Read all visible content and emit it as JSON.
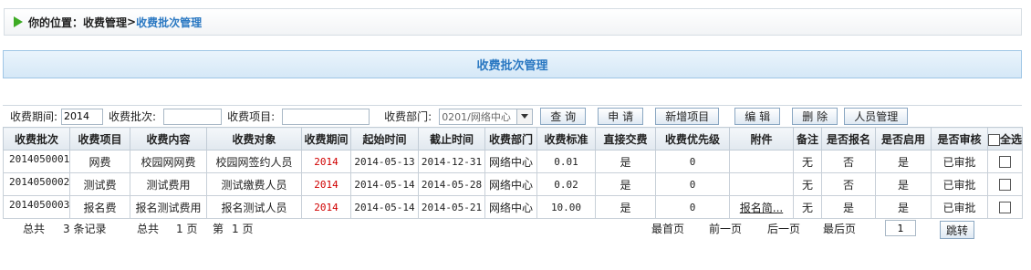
{
  "breadcrumb": {
    "prefix": "你的位置：",
    "parent": "收费管理",
    "separator": ">",
    "current": "收费批次管理"
  },
  "page_title": "收费批次管理",
  "filter": {
    "period_label": "收费期间:",
    "period_value": "2014",
    "batch_label": "收费批次:",
    "batch_value": "",
    "item_label": "收费项目:",
    "item_value": "",
    "dept_label": "收费部门:",
    "dept_selected": "0201/网络中心",
    "buttons": {
      "query": "查 询",
      "apply": "申 请",
      "add_item": "新增项目",
      "edit": "编 辑",
      "delete": "删 除",
      "staff": "人员管理"
    }
  },
  "table": {
    "headers": [
      "收费批次",
      "收费项目",
      "收费内容",
      "收费对象",
      "收费期间",
      "起始时间",
      "截止时间",
      "收费部门",
      "收费标准",
      "直接交费",
      "收费优先级",
      "附件",
      "备注",
      "是否报名",
      "是否启用",
      "是否审核"
    ],
    "select_all_label": "全选",
    "rows": [
      {
        "batch": "2014050001",
        "item": "网费",
        "content": "校园网网费",
        "target": "校园网签约人员",
        "period": "2014",
        "start": "2014-05-13",
        "end": "2014-12-31",
        "dept": "网络中心",
        "standard": "0.01",
        "direct": "是",
        "priority": "0",
        "attachment": "",
        "remark": "无",
        "signup": "否",
        "enabled": "是",
        "audit": "已审批"
      },
      {
        "batch": "2014050002",
        "item": "测试费",
        "content": "测试费用",
        "target": "测试缴费人员",
        "period": "2014",
        "start": "2014-05-14",
        "end": "2014-05-28",
        "dept": "网络中心",
        "standard": "0.02",
        "direct": "是",
        "priority": "0",
        "attachment": "",
        "remark": "无",
        "signup": "否",
        "enabled": "是",
        "audit": "已审批"
      },
      {
        "batch": "2014050003",
        "item": "报名费",
        "content": "报名测试费用",
        "target": "报名测试人员",
        "period": "2014",
        "start": "2014-05-14",
        "end": "2014-05-21",
        "dept": "网络中心",
        "standard": "10.00",
        "direct": "是",
        "priority": "0",
        "attachment": "报名简...",
        "remark": "无",
        "signup": "是",
        "enabled": "是",
        "audit": "已审批"
      }
    ]
  },
  "footer": {
    "total_prefix": "总共",
    "total_records": "3 条记录",
    "pages_prefix": "总共",
    "pages_value": "1 页",
    "current_prefix": "第",
    "current_value": "1 页",
    "first": "最首页",
    "prev": "前一页",
    "next": "后一页",
    "last": "最后页",
    "page_input": "1",
    "jump": "跳转"
  },
  "colors": {
    "accent_blue": "#2a78c2",
    "period_red": "#d00000",
    "arrow_green": "#3dab24"
  }
}
